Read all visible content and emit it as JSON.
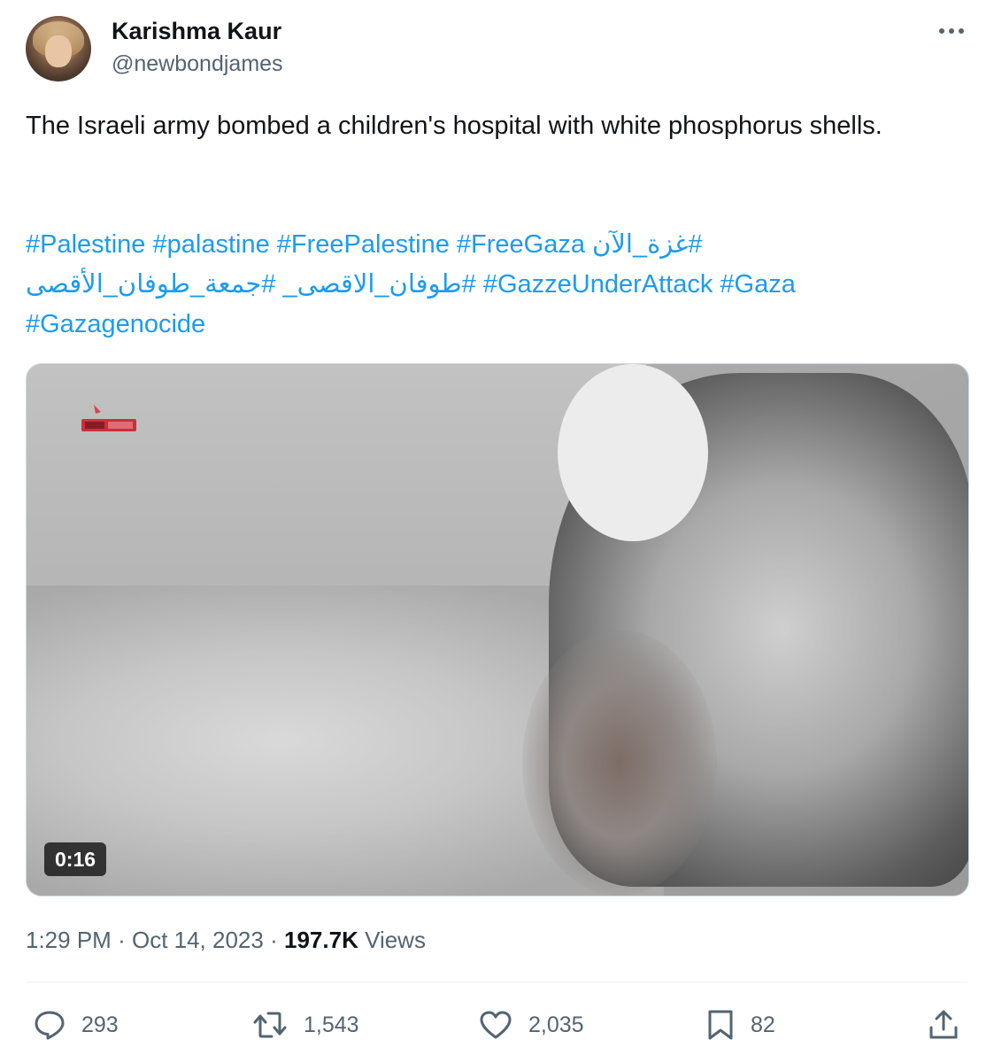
{
  "author": {
    "name": "Karishma Kaur",
    "handle": "@newbondjames"
  },
  "tweet": {
    "text": "The Israeli army bombed a children's hospital with white phosphorus shells.",
    "hashtags_line1": [
      "#Palestine",
      "#palastine",
      "#FreePalestine",
      "#FreeGaza",
      "#غزة_الآن"
    ],
    "hashtags_line2": [
      "#جمعة_طوفان_الأقصى",
      "#طوفان_الاقصى_",
      "#GazzeUnderAttack",
      "#Gaza"
    ],
    "hashtags_line3": [
      "#Gazagenocide"
    ]
  },
  "media": {
    "type": "video",
    "duration": "0:16"
  },
  "meta": {
    "time": "1:29 PM",
    "separator": "·",
    "date": "Oct 14, 2023",
    "views_count": "197.7K",
    "views_label": "Views"
  },
  "actions": {
    "replies": "293",
    "retweets": "1,543",
    "likes": "2,035",
    "bookmarks": "82"
  },
  "icons": {
    "more": "more-horizontal-icon",
    "reply": "reply-icon",
    "retweet": "retweet-icon",
    "like": "heart-icon",
    "bookmark": "bookmark-icon",
    "share": "share-icon"
  },
  "colors": {
    "link": "#1d9bf0",
    "secondary_text": "#536471",
    "primary_text": "#0f1419"
  }
}
